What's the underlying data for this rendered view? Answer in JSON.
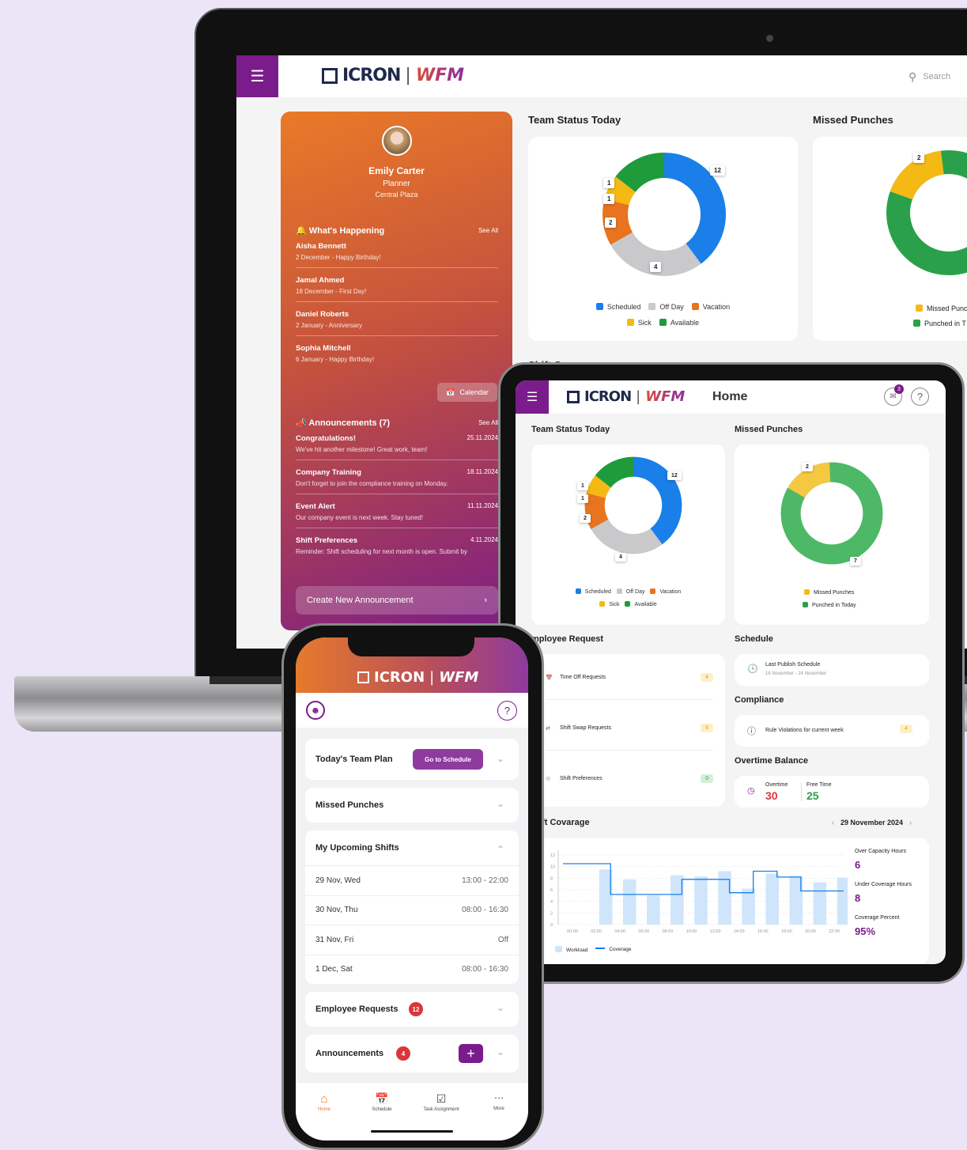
{
  "brand": {
    "icron": "ICRON",
    "separator": "|",
    "wfm": "WFM"
  },
  "laptop": {
    "search_placeholder": "Search",
    "profile": {
      "name": "Emily Carter",
      "role": "Planner",
      "location": "Central Plaza"
    },
    "whats_happening": {
      "title": "What's Happening",
      "see_all": "See All",
      "items": [
        {
          "name": "Aisha Bennett",
          "detail": "2 December - Happy Birthday!"
        },
        {
          "name": "Jamal Ahmed",
          "detail": "18 December - First Day!"
        },
        {
          "name": "Daniel Roberts",
          "detail": "2 January - Anniversary"
        },
        {
          "name": "Sophia Mitchell",
          "detail": "6 January - Happy Birthday!"
        }
      ],
      "calendar_label": "Calendar"
    },
    "announcements": {
      "title": "Announcements (7)",
      "see_all": "See All",
      "items": [
        {
          "title": "Congratulations!",
          "date": "25.11.2024",
          "text": "We've hit another milestone! Great work, team!"
        },
        {
          "title": "Company Training",
          "date": "18.11.2024",
          "text": "Don't forget to join the compliance training on Monday."
        },
        {
          "title": "Event Alert",
          "date": "11.11.2024",
          "text": "Our company event is next week. Stay tuned!"
        },
        {
          "title": "Shift Preferences",
          "date": "4.11.2024",
          "text": "Reminder: Shift scheduling for next month is open. Submit by"
        }
      ],
      "create_label": "Create New Announcement"
    },
    "team_status_title": "Team Status Today",
    "missed_punches_title": "Missed Punches",
    "shift_coverage_title": "Shift C"
  },
  "team_status": {
    "labels": [
      "12",
      "1",
      "1",
      "2",
      "4"
    ],
    "legend": [
      {
        "label": "Scheduled",
        "color": "#1a7fe8"
      },
      {
        "label": "Off Day",
        "color": "#c9c9cc"
      },
      {
        "label": "Vacation",
        "color": "#e8741f"
      },
      {
        "label": "Sick",
        "color": "#f5b914"
      },
      {
        "label": "Available",
        "color": "#1f9b3c"
      }
    ]
  },
  "missed_punches": {
    "labels": [
      "2",
      "7"
    ],
    "legend": [
      {
        "label": "Missed Punches",
        "color": "#f5b914"
      },
      {
        "label": "Punched in Today",
        "color": "#2aa04a"
      }
    ],
    "laptop_legend": [
      "Missed Punc",
      "Punched in T"
    ]
  },
  "tablet": {
    "page_title": "Home",
    "notif_count": "3",
    "team_status_title": "Team Status Today",
    "missed_punches_title": "Missed Punches",
    "employee_request_title": "mployee Request",
    "requests": [
      {
        "label": "Time Off Requests",
        "count": "4"
      },
      {
        "label": "Shift Swap Requests",
        "count": "6"
      },
      {
        "label": "Shift Preferences",
        "count": "0"
      }
    ],
    "schedule_title": "Schedule",
    "last_publish": {
      "label": "Last Publish Schedule",
      "range": "18 November - 24 November"
    },
    "compliance_title": "Compliance",
    "rule_violations": {
      "label": "Rule Violations for current week",
      "count": "4"
    },
    "overtime_title": "Overtime Balance",
    "overtime": {
      "label": "Overtime",
      "value": "30"
    },
    "free_time": {
      "label": "Free Time",
      "value": "25"
    },
    "coverage_title": "ift Covarage",
    "coverage_date": "29 November 2024",
    "stats": [
      {
        "label": "Over Capacity Hours",
        "value": "6"
      },
      {
        "label": "Under Coverage Hours",
        "value": "8"
      },
      {
        "label": "Coverage Percent",
        "value": "95%"
      }
    ],
    "legend_workload": "Workload",
    "legend_coverage": "Coverage"
  },
  "chart_data": {
    "type": "bar",
    "categories": [
      "00:00",
      "02:00",
      "04:00",
      "06:00",
      "08:00",
      "10:00",
      "12:00",
      "14:00",
      "16:00",
      "18:00",
      "20:00",
      "22:00"
    ],
    "y_ticks": [
      "0",
      "2",
      "4",
      "6",
      "8",
      "10",
      "12"
    ],
    "ylim": [
      0,
      12
    ],
    "series": [
      {
        "name": "Workload",
        "type": "bar",
        "values": [
          0,
          9.5,
          7.8,
          5,
          8.5,
          8.3,
          9.2,
          6.2,
          8.8,
          8.4,
          7.3,
          8.1
        ]
      },
      {
        "name": "Coverage",
        "type": "step",
        "values": [
          10.5,
          10.5,
          5.2,
          5.2,
          5.2,
          7.8,
          7.8,
          5.5,
          9.2,
          8.2,
          5.8,
          5.8
        ]
      }
    ]
  },
  "phone": {
    "team_plan_title": "Today's Team Plan",
    "go_to_schedule": "Go to Schedule",
    "missed_punches": "Missed Punches",
    "upcoming_title": "My Upcoming Shifts",
    "shifts": [
      {
        "day": "29 Nov, Wed",
        "time": "13:00 - 22:00"
      },
      {
        "day": "30 Nov, Thu",
        "time": "08:00 - 16:30"
      },
      {
        "day": "31 Nov, Fri",
        "time": "Off"
      },
      {
        "day": "1 Dec, Sat",
        "time": "08:00 - 16:30"
      }
    ],
    "employee_requests": "Employee Requests",
    "employee_requests_count": "12",
    "announcements": "Announcements",
    "announcements_count": "4",
    "nav": [
      "Home",
      "Schedule",
      "Task Assignment",
      "More"
    ]
  }
}
